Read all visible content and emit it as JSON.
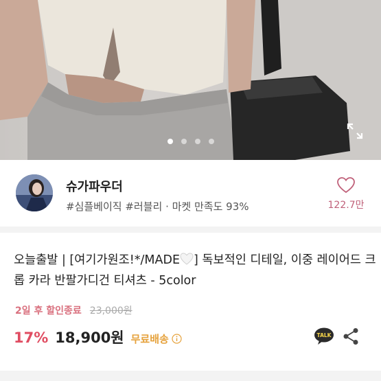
{
  "gallery": {
    "dots": [
      "active",
      "inactive",
      "inactive",
      "inactive"
    ],
    "expand_icon": "expand-icon"
  },
  "seller": {
    "name": "슈가파우더",
    "tags": "#심플베이직 #러블리 · 마켓 만족도 93%",
    "likes": "122.7만",
    "like_icon": "heart-outline-icon",
    "colors": {
      "like": "#c0617a"
    }
  },
  "product": {
    "title_part1": "오늘출발 | [여기가원조!*/MADE",
    "title_part2": "] 독보적인 디테일, 이중 레이어드 크롭 카라 반팔가디건 티셔츠 - 5color",
    "discount_end": "2일 후 할인종료",
    "original_price": "23,000원",
    "discount_rate": "17%",
    "price": "18,900원",
    "shipping": "무료배송",
    "talk_label": "TALK",
    "colors": {
      "discount": "#e04d62",
      "shipping": "#e6a23c",
      "deadline": "#d9707e"
    }
  }
}
